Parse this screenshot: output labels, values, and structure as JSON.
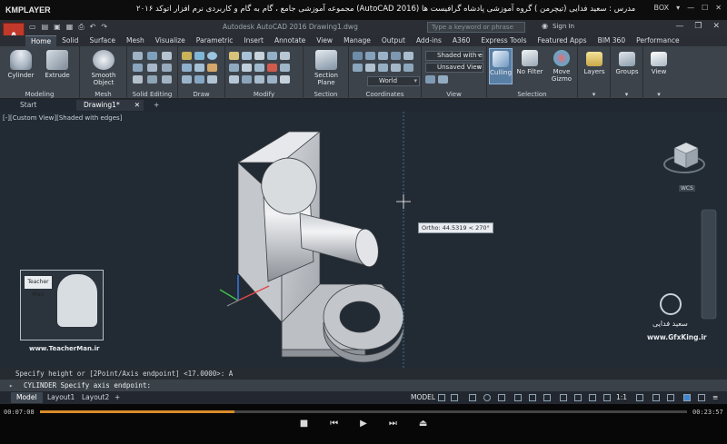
{
  "player": {
    "logo": "KMPLAYER",
    "video_title": "مجموعه آموزشی جامع ، گام به گام و کاربردی نرم افزار  اتوکد ۲۰۱۶ (AutoCAD 2016)  مدرس : سعید فدایی (تیچرمن ) گروه آموزشی پادشاه گرافیست ها",
    "box_label": "BOX",
    "time_elapsed": "00:07:08",
    "time_total": "00:23:57",
    "progress_fraction": 0.3
  },
  "titlebar": {
    "app_title": "Autodesk AutoCAD 2016    Drawing1.dwg",
    "search_placeholder": "Type a keyword or phrase",
    "signin": "Sign In",
    "app_menu_letter": "A"
  },
  "tabs": [
    "Home",
    "Solid",
    "Surface",
    "Mesh",
    "Visualize",
    "Parametric",
    "Insert",
    "Annotate",
    "View",
    "Manage",
    "Output",
    "Add-ins",
    "A360",
    "Express Tools",
    "Featured Apps",
    "BIM 360",
    "Performance"
  ],
  "active_tab_index": 0,
  "ribbon": {
    "modeling": {
      "label": "Modeling",
      "cylinder": "Cylinder",
      "extrude": "Extrude"
    },
    "mesh": {
      "label": "Mesh",
      "smooth_object": "Smooth Object"
    },
    "solid_editing": {
      "label": "Solid Editing"
    },
    "draw": {
      "label": "Draw"
    },
    "modify": {
      "label": "Modify"
    },
    "section": {
      "label": "Section",
      "section_plane": "Section Plane"
    },
    "coordinates": {
      "label": "Coordinates",
      "world": "World"
    },
    "view": {
      "label": "View",
      "visual_style": "Shaded with e...",
      "saved_view": "Unsaved View"
    },
    "selection": {
      "label": "Selection",
      "culling": "Culling",
      "no_filter": "No Filter",
      "move_gizmo": "Move Gizmo"
    },
    "layers": "Layers",
    "groups": "Groups",
    "view_btn": "View"
  },
  "file_tabs": {
    "start": "Start",
    "drawing": "Drawing1*"
  },
  "viewport": {
    "label": "[-][Custom View][Shaded with edges]",
    "tooltip": "Ortho: 44.5319 < 270°",
    "viewcube_wcs": "WCS",
    "watermark_left_url": "www.TeacherMan.ir",
    "watermark_left_name": "Teacher Man",
    "watermark_right_name": "سعید فدایی",
    "watermark_right_url": "www.GfxKing.ir"
  },
  "command": {
    "history": "Specify height or [2Point/Axis endpoint] <17.0000>: A",
    "prompt": "CYLINDER Specify axis endpoint:"
  },
  "layout_tabs": [
    "Model",
    "Layout1",
    "Layout2"
  ],
  "status": {
    "model": "MODEL",
    "scale": "1:1"
  },
  "colors": {
    "viewport_bg": "#222a33",
    "ribbon_bg": "#3d434b",
    "accent_red": "#c0392b",
    "progress": "#d98b2b"
  }
}
